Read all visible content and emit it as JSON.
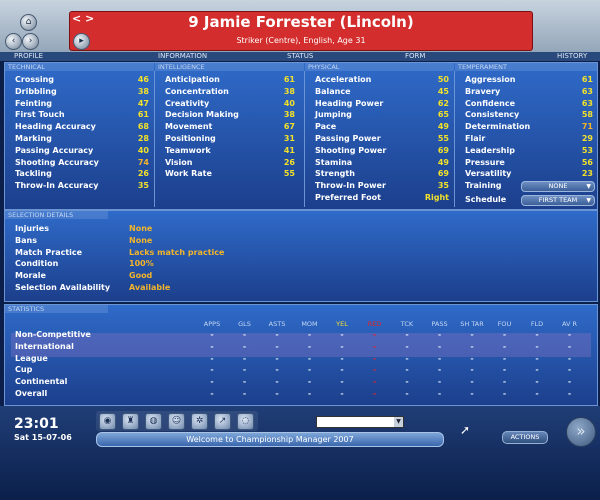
{
  "header": {
    "nav_arrows": "< >",
    "player_title": "9 Jamie Forrester (Lincoln)",
    "player_subtitle": "Striker (Centre), English, Age 31"
  },
  "tabs": [
    "PROFILE",
    "INFORMATION",
    "STATUS",
    "FORM",
    "HISTORY"
  ],
  "technical": {
    "heading": "TECHNICAL",
    "items": [
      {
        "name": "Crossing",
        "value": "46"
      },
      {
        "name": "Dribbling",
        "value": "38"
      },
      {
        "name": "Feinting",
        "value": "47"
      },
      {
        "name": "First Touch",
        "value": "61"
      },
      {
        "name": "Heading Accuracy",
        "value": "68"
      },
      {
        "name": "Marking",
        "value": "28"
      },
      {
        "name": "Passing Accuracy",
        "value": "40"
      },
      {
        "name": "Shooting Accuracy",
        "value": "74"
      },
      {
        "name": "Tackling",
        "value": "26"
      },
      {
        "name": "Throw-In Accuracy",
        "value": "35"
      }
    ]
  },
  "intelligence": {
    "heading": "INTELLIGENCE",
    "items": [
      {
        "name": "Anticipation",
        "value": "61"
      },
      {
        "name": "Concentration",
        "value": "38"
      },
      {
        "name": "Creativity",
        "value": "40"
      },
      {
        "name": "Decision Making",
        "value": "38"
      },
      {
        "name": "Movement",
        "value": "67"
      },
      {
        "name": "Positioning",
        "value": "31"
      },
      {
        "name": "Teamwork",
        "value": "41"
      },
      {
        "name": "Vision",
        "value": "26"
      },
      {
        "name": "Work Rate",
        "value": "55"
      }
    ]
  },
  "physical": {
    "heading": "PHYSICAL",
    "items": [
      {
        "name": "Acceleration",
        "value": "50"
      },
      {
        "name": "Balance",
        "value": "45"
      },
      {
        "name": "Heading Power",
        "value": "62"
      },
      {
        "name": "Jumping",
        "value": "65"
      },
      {
        "name": "Pace",
        "value": "49"
      },
      {
        "name": "Passing Power",
        "value": "55"
      },
      {
        "name": "Shooting Power",
        "value": "69"
      },
      {
        "name": "Stamina",
        "value": "49"
      },
      {
        "name": "Strength",
        "value": "69"
      },
      {
        "name": "Throw-In Power",
        "value": "35"
      },
      {
        "name": "Preferred Foot",
        "value": "Right"
      }
    ]
  },
  "temperament": {
    "heading": "TEMPERAMENT",
    "items": [
      {
        "name": "Aggression",
        "value": "61"
      },
      {
        "name": "Bravery",
        "value": "63"
      },
      {
        "name": "Confidence",
        "value": "63"
      },
      {
        "name": "Consistency",
        "value": "58"
      },
      {
        "name": "Determination",
        "value": "71"
      },
      {
        "name": "Flair",
        "value": "29"
      },
      {
        "name": "Leadership",
        "value": "53"
      },
      {
        "name": "Pressure",
        "value": "56"
      },
      {
        "name": "Versatility",
        "value": "23"
      }
    ],
    "training_label": "Training",
    "training_value": "NONE",
    "schedule_label": "Schedule",
    "schedule_value": "FIRST TEAM"
  },
  "selection": {
    "heading": "SELECTION DETAILS",
    "items": [
      {
        "name": "Injuries",
        "value": "None"
      },
      {
        "name": "Bans",
        "value": "None"
      },
      {
        "name": "Match Practice",
        "value": "Lacks match practice"
      },
      {
        "name": "Condition",
        "value": "100%"
      },
      {
        "name": "Morale",
        "value": "Good"
      },
      {
        "name": "Selection Availability",
        "value": "Available"
      }
    ]
  },
  "statistics": {
    "heading": "STATISTICS",
    "columns": [
      "APPS",
      "GLS",
      "ASTS",
      "MOM",
      "YEL",
      "RED",
      "TCK",
      "PASS",
      "SH TAR",
      "FOU",
      "FLD",
      "AV R"
    ],
    "column_colors": [
      "#c5d7f2",
      "#c5d7f2",
      "#c5d7f2",
      "#c5d7f2",
      "#f2e12a",
      "#e0262b",
      "#c5d7f2",
      "#c5d7f2",
      "#c5d7f2",
      "#c5d7f2",
      "#c5d7f2",
      "#c5d7f2"
    ],
    "rows": [
      {
        "label": "Non-Competitive",
        "cells": [
          "-",
          "-",
          "-",
          "-",
          "-",
          "-",
          "-",
          "-",
          "-",
          "-",
          "-",
          "-"
        ]
      },
      {
        "label": "International",
        "cells": [
          "-",
          "-",
          "-",
          "-",
          "-",
          "-",
          "-",
          "-",
          "-",
          "-",
          "-",
          "-"
        ]
      },
      {
        "label": "League",
        "cells": [
          "-",
          "-",
          "-",
          "-",
          "-",
          "-",
          "-",
          "-",
          "-",
          "-",
          "-",
          "-"
        ]
      },
      {
        "label": "Cup",
        "cells": [
          "-",
          "-",
          "-",
          "-",
          "-",
          "-",
          "-",
          "-",
          "-",
          "-",
          "-",
          "-"
        ]
      },
      {
        "label": "Continental",
        "cells": [
          "-",
          "-",
          "-",
          "-",
          "-",
          "-",
          "-",
          "-",
          "-",
          "-",
          "-",
          "-"
        ]
      },
      {
        "label": "Overall",
        "cells": [
          "-",
          "-",
          "-",
          "-",
          "-",
          "-",
          "-",
          "-",
          "-",
          "-",
          "-",
          "-"
        ]
      }
    ]
  },
  "footer": {
    "time": "23:01",
    "date": "Sat 15-07-06",
    "message": "Welcome to Championship Manager 2007",
    "actions_label": "ACTIONS",
    "icons": [
      "globe-icon",
      "trophy-icon",
      "world-icon",
      "people-icon",
      "settings-icon",
      "chart-icon",
      "options-icon"
    ]
  }
}
